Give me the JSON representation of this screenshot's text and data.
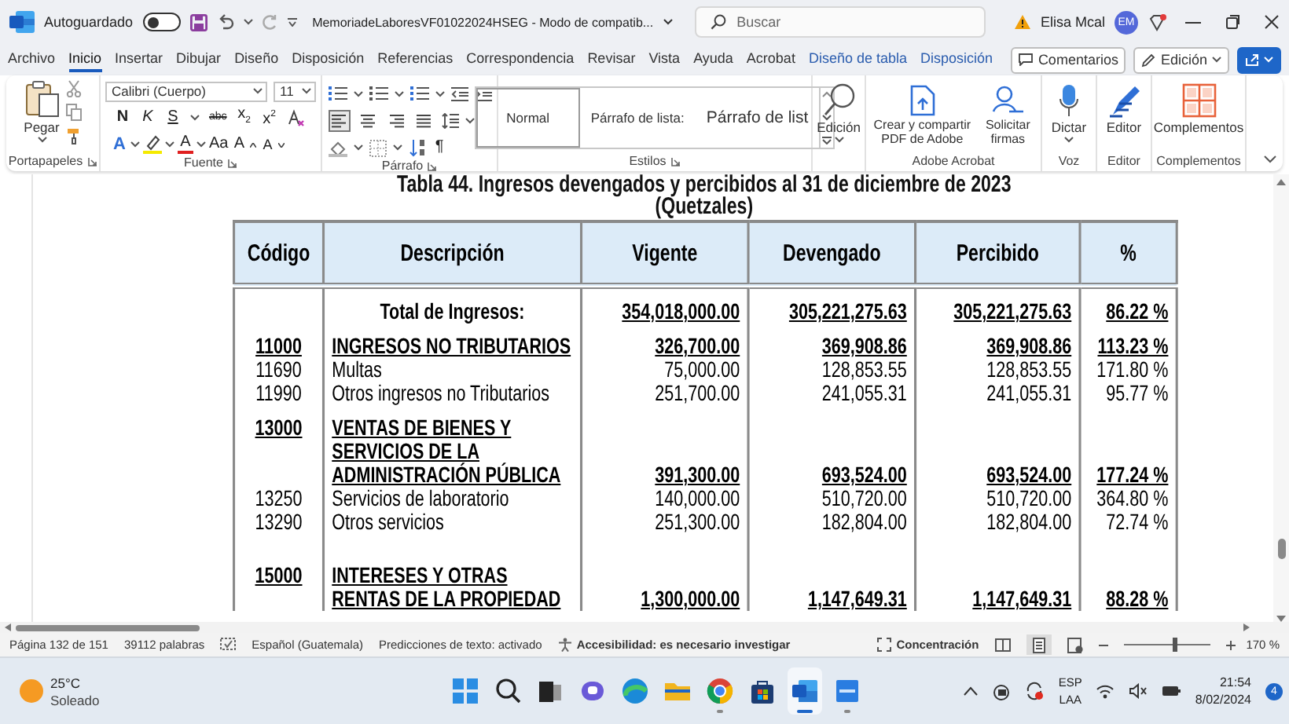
{
  "window": {
    "title": "MemoriadeLaboresVF01022024HSEG - Modo de compatib...",
    "autosave": {
      "label": "Autoguardado",
      "on": false
    },
    "search": {
      "placeholder": "Buscar"
    },
    "user": {
      "name": "Elisa Mcal",
      "initials": "EM"
    }
  },
  "menu": {
    "tabs": [
      {
        "label": "Archivo",
        "selected": false,
        "contextual": false
      },
      {
        "label": "Inicio",
        "selected": true,
        "contextual": false
      },
      {
        "label": "Insertar",
        "selected": false,
        "contextual": false
      },
      {
        "label": "Dibujar",
        "selected": false,
        "contextual": false
      },
      {
        "label": "Diseño",
        "selected": false,
        "contextual": false
      },
      {
        "label": "Disposición",
        "selected": false,
        "contextual": false
      },
      {
        "label": "Referencias",
        "selected": false,
        "contextual": false
      },
      {
        "label": "Correspondencia",
        "selected": false,
        "contextual": false
      },
      {
        "label": "Revisar",
        "selected": false,
        "contextual": false
      },
      {
        "label": "Vista",
        "selected": false,
        "contextual": false
      },
      {
        "label": "Ayuda",
        "selected": false,
        "contextual": false
      },
      {
        "label": "Acrobat",
        "selected": false,
        "contextual": false
      },
      {
        "label": "Diseño de tabla",
        "selected": false,
        "contextual": true
      },
      {
        "label": "Disposición",
        "selected": false,
        "contextual": true
      }
    ],
    "buttons": [
      {
        "kind": "comments",
        "label": "Comentarios"
      },
      {
        "kind": "mode",
        "label": "Edición"
      },
      {
        "kind": "share"
      }
    ]
  },
  "ribbon": {
    "groups": [
      {
        "kind": "clipboard",
        "label": "Portapapeles",
        "button": "Pegar"
      },
      {
        "kind": "font",
        "label": "Fuente",
        "font": "Calibri (Cuerpo)",
        "size": "11",
        "row_1": [
          {
            "kind": "bold",
            "label": "N"
          },
          {
            "kind": "italic",
            "label": "K"
          },
          {
            "kind": "underline",
            "label": "S"
          },
          {
            "kind": "strike",
            "label": "abc"
          },
          {
            "kind": "plain",
            "label": "x$_{2}$"
          },
          {
            "kind": "plain",
            "label": "x$^{2}$"
          },
          {
            "kind": "clear"
          }
        ],
        "row_2": [
          {
            "kind": "effects",
            "label": "A"
          },
          {
            "kind": "highlight"
          },
          {
            "kind": "color",
            "label": "A"
          },
          {
            "kind": "plain",
            "label": "Aa"
          },
          {
            "kind": "grow",
            "label": "A"
          },
          {
            "kind": "shrink",
            "label": "A"
          }
        ]
      },
      {
        "kind": "paragraph",
        "label": "Párrafo",
        "alignments": [
          {
            "kind": "left",
            "selected": true
          },
          {
            "kind": "center",
            "selected": false
          },
          {
            "kind": "right",
            "selected": false
          },
          {
            "kind": "justify",
            "selected": false
          }
        ],
        "marks": "¶"
      },
      {
        "kind": "styles",
        "label": "Estilos",
        "styles": [
          {
            "label": "Normal",
            "selected": true
          },
          {
            "label": "Párrafo de lista:",
            "selected": false
          },
          {
            "label": "Párrafo de list",
            "selected": false
          }
        ]
      },
      {
        "kind": "editing",
        "button": "Edición"
      },
      {
        "kind": "acrobat",
        "label": "Adobe Acrobat",
        "buttons": [
          {
            "kind": "pdf",
            "label": "Crear y compartir PDF de Adobe"
          },
          {
            "kind": "sign",
            "label": "Solicitar firmas"
          }
        ]
      },
      {
        "kind": "voice",
        "label": "Voz",
        "button": "Dictar"
      },
      {
        "kind": "editor",
        "label": "Editor",
        "button": "Editor"
      },
      {
        "kind": "addins",
        "label": "Complementos",
        "button": "Complementos"
      }
    ]
  },
  "document": {
    "title": "Tabla 44. Ingresos devengados y percibidos al 31 de diciembre de 2023",
    "subtitle": "(Quetzales)",
    "table": {
      "columns": [
        "Código",
        "Descripción",
        "Vigente",
        "Devengado",
        "Percibido",
        "%"
      ],
      "rows": [
        {
          "kind": "total",
          "description": "Total de Ingresos:",
          "vigente": "354,018,000.00",
          "devengado": "305,221,275.63",
          "percibido": "305,221,275.63",
          "percent": "86.22 %"
        },
        {
          "kind": "group",
          "code": "11000",
          "description": "INGRESOS NO TRIBUTARIOS",
          "vigente": "326,700.00",
          "devengado": "369,908.86",
          "percibido": "369,908.86",
          "percent": "113.23 %"
        },
        {
          "kind": "item",
          "code": "11690",
          "description": "Multas",
          "vigente": "75,000.00",
          "devengado": "128,853.55",
          "percibido": "128,853.55",
          "percent": "171.80 %"
        },
        {
          "kind": "item",
          "code": "11990",
          "description": "Otros ingresos no Tributarios",
          "vigente": "251,700.00",
          "devengado": "241,055.31",
          "percibido": "241,055.31",
          "percent": "95.77 %"
        },
        {
          "kind": "group",
          "code": "13000",
          "description": "VENTAS DE BIENES Y SERVICIOS DE LA ADMINISTRACIÓN PÚBLICA",
          "vigente": "391,300.00",
          "devengado": "693,524.00",
          "percibido": "693,524.00",
          "percent": "177.24 %"
        },
        {
          "kind": "item",
          "code": "13250",
          "description": "Servicios de laboratorio",
          "vigente": "140,000.00",
          "devengado": "510,720.00",
          "percibido": "510,720.00",
          "percent": "364.80 %"
        },
        {
          "kind": "item",
          "code": "13290",
          "description": "Otros servicios",
          "vigente": "251,300.00",
          "devengado": "182,804.00",
          "percibido": "182,804.00",
          "percent": "72.74 %"
        },
        {
          "kind": "blank"
        },
        {
          "kind": "group",
          "code": "15000",
          "description": "INTERESES Y OTRAS RENTAS DE LA PROPIEDAD",
          "vigente": "1,300,000.00",
          "devengado": "1,147,649.31",
          "percibido": "1,147,649.31",
          "percent": "88.28 %"
        }
      ]
    }
  },
  "status_bar": {
    "page": "Página 132 de 151",
    "words": "39112 palabras",
    "language": "Español (Guatemala)",
    "predictions": "Predicciones de texto: activado",
    "accessibility": "Accesibilidad: es necesario investigar",
    "focus": "Concentración",
    "views": [
      {
        "kind": "read",
        "selected": false
      },
      {
        "kind": "print",
        "selected": true
      },
      {
        "kind": "web",
        "selected": false
      }
    ],
    "zoom": {
      "level": 0.59,
      "reading": "170 %"
    }
  },
  "taskbar": {
    "weather": {
      "temperature": "25°C",
      "condition": "Soleado"
    },
    "apps": [
      {
        "kind": "start",
        "open": false,
        "selected": false
      },
      {
        "kind": "search",
        "open": false,
        "selected": false
      },
      {
        "kind": "taskview",
        "open": false,
        "selected": false
      },
      {
        "kind": "chat",
        "open": false,
        "selected": false
      },
      {
        "kind": "edge",
        "open": false,
        "selected": false
      },
      {
        "kind": "explorer",
        "open": false,
        "selected": false
      },
      {
        "kind": "chrome",
        "open": true,
        "selected": false
      },
      {
        "kind": "store",
        "open": false,
        "selected": false
      },
      {
        "kind": "word",
        "open": true,
        "selected": true
      },
      {
        "kind": "app",
        "open": true,
        "selected": false
      }
    ],
    "input_language": "ESP",
    "keyboard": "LAA",
    "time": "21:54",
    "date": "8/02/2024",
    "notifications": "4"
  }
}
